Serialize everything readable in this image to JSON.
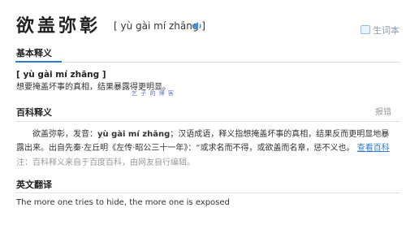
{
  "header": {
    "word": "欲盖弥彰",
    "pinyin": "[ yù gài mí zhāng ]",
    "speaker_icon": "speaker-icon",
    "new_word_label": "生词本",
    "new_word_icon": "notebook-icon"
  },
  "tabs": {
    "basic_label": "基本释义",
    "accent_color": "#2f7bd3"
  },
  "basic": {
    "pinyin": "[ yù gài mí zhāng ]",
    "definition": "想要掩盖坏事的真相，结果暴露得更明显。",
    "overlay_watermark": "乞 子 的 博 客"
  },
  "baike": {
    "title": "百科释义",
    "report_label": "报错",
    "text_before": "欲盖弥彰，发音：",
    "pinyin_bold": "yù gài mí zhāng",
    "text_after": "；汉语成语，释义指想掩盖坏事的真相，结果反而更明显地暴露出来。出自先秦·左丘明《左传·昭公三十一年》：“或求名而不得，或欲盖而名章，惩不义也。",
    "more_link": "查看百科",
    "note": "注：百科释义来自于百度百科，由网友自行编辑。"
  },
  "english": {
    "title": "英文翻译",
    "translation": "The more one tries to hide, the more one is exposed"
  }
}
